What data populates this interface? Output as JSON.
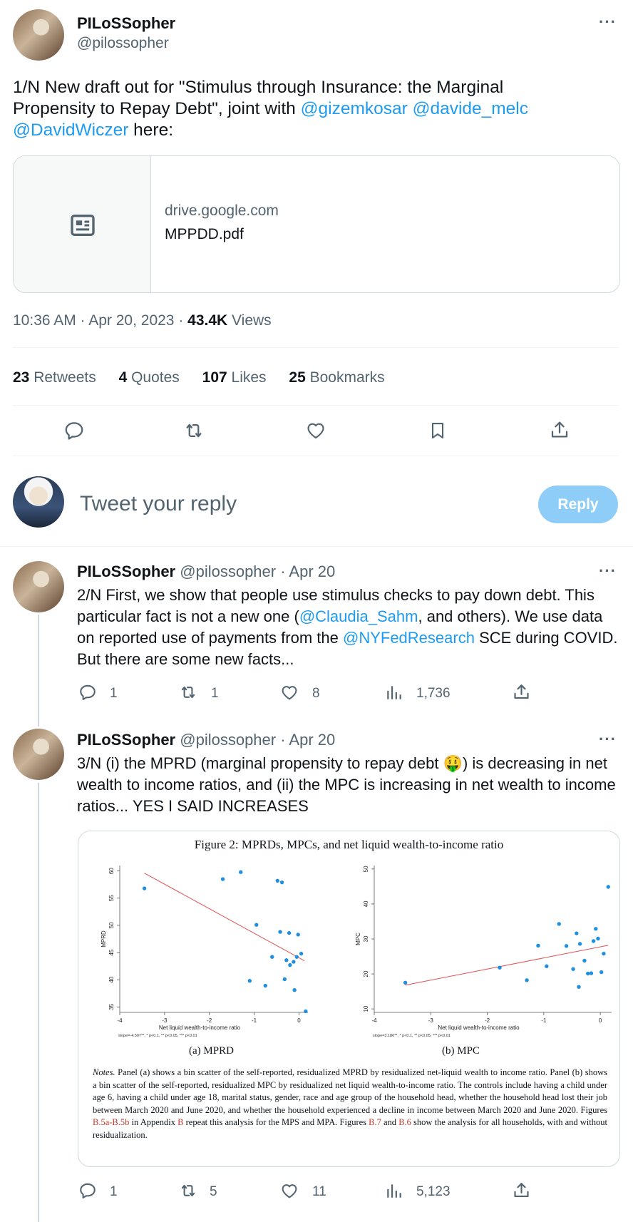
{
  "main_tweet": {
    "author_name": "PILoSSopher",
    "author_handle": "@pilossopher",
    "text_prefix": "1/N New draft out for \"Stimulus through Insurance: the Marginal Propensity to Repay Debt\", joint with ",
    "mention1": "@gizemkosar",
    "mention2": "@davide_melc",
    "mention3": "@DavidWiczer",
    "text_suffix": " here:",
    "link_card": {
      "domain": "drive.google.com",
      "title": "MPPDD.pdf"
    },
    "meta_time": "10:36 AM · Apr 20, 2023 · ",
    "views_count": "43.4K",
    "views_label": " Views",
    "stats": [
      {
        "count": "23",
        "label": " Retweets"
      },
      {
        "count": "4",
        "label": " Quotes"
      },
      {
        "count": "107",
        "label": " Likes"
      },
      {
        "count": "25",
        "label": " Bookmarks"
      }
    ],
    "more": "···"
  },
  "reply_box": {
    "placeholder": "Tweet your reply",
    "button": "Reply"
  },
  "replies": [
    {
      "author_name": "PILoSSopher",
      "handle_date": "@pilossopher · Apr 20",
      "more": "···",
      "text_a": "2/N First, we show that people use stimulus checks to pay down debt. This particular fact is not a new one (",
      "mention_a": "@Claudia_Sahm",
      "text_b": ", and others). We use data on reported use of payments from the ",
      "mention_b": "@NYFedResearch",
      "text_c": " SCE during COVID. But there are some new facts...",
      "actions": {
        "replies": "1",
        "retweets": "1",
        "likes": "8",
        "views": "1,736"
      }
    },
    {
      "author_name": "PILoSSopher",
      "handle_date": "@pilossopher · Apr 20",
      "more": "···",
      "text_a": "3/N (i) the MPRD (marginal propensity to repay debt ",
      "emoji": "🤑",
      "text_b": ") is decreasing in net wealth to income ratios, and (ii) the MPC is increasing in net wealth to income ratios... YES I SAID INCREASES",
      "actions": {
        "replies": "1",
        "retweets": "5",
        "likes": "11",
        "views": "5,123"
      }
    }
  ],
  "figure": {
    "title": "Figure 2: MPRDs, MPCs, and net liquid wealth-to-income ratio",
    "notes_label": "Notes.",
    "notes_1": " Panel (a) shows a bin scatter of the self-reported, residualized MPRD by residualized net-liquid wealth to income ratio. Panel (b) shows a bin scatter of the self-reported, residualized MPC by residualized net liquid wealth-to-income ratio.  The controls include having a child under age 6, having a child under age 18, marital status, gender, race and age group of the household head, whether the household head lost their job between March 2020 and June 2020, and whether the household experienced a decline in income between March 2020 and June 2020. Figures ",
    "notes_ref1": "B.5a-B.5b",
    "notes_2": " in Appendix ",
    "notes_ref2": "B",
    "notes_3": " repeat this analysis for the MPS and MPA. Figures ",
    "notes_ref3": "B.7",
    "notes_4": " and ",
    "notes_ref4": "B.6",
    "notes_5": " show the analysis for all households, with and without residualization."
  },
  "chart_data": [
    {
      "type": "scatter",
      "panel_caption": "(a) MPRD",
      "xlabel": "Net liquid wealth-to-income ratio",
      "ylabel": "MPRD",
      "footnote": "slope=-4.507**, * p<0.1, ** p<0.05, *** p<0.01",
      "xlim": [
        -4,
        0.2
      ],
      "ylim": [
        34,
        61
      ],
      "x_ticks": [
        "-4",
        "-3",
        "-2",
        "-1",
        "0"
      ],
      "x_tick_values": [
        -4,
        -3,
        -2,
        -1,
        0
      ],
      "y_ticks": [
        "35",
        "40",
        "45",
        "50",
        "55",
        "60"
      ],
      "y_tick_values": [
        35,
        40,
        45,
        50,
        55,
        60
      ],
      "points": [
        {
          "x": -3.45,
          "y": 56.8
        },
        {
          "x": -1.7,
          "y": 58.5
        },
        {
          "x": -1.3,
          "y": 59.8
        },
        {
          "x": -0.95,
          "y": 50.1
        },
        {
          "x": -1.1,
          "y": 39.8
        },
        {
          "x": -0.75,
          "y": 38.9
        },
        {
          "x": -0.6,
          "y": 44.2
        },
        {
          "x": -0.48,
          "y": 58.2
        },
        {
          "x": -0.38,
          "y": 57.9
        },
        {
          "x": -0.42,
          "y": 48.8
        },
        {
          "x": -0.22,
          "y": 48.6
        },
        {
          "x": -0.02,
          "y": 48.3
        },
        {
          "x": -0.28,
          "y": 43.6
        },
        {
          "x": -0.2,
          "y": 42.7
        },
        {
          "x": -0.12,
          "y": 43.3
        },
        {
          "x": -0.05,
          "y": 44.2
        },
        {
          "x": 0.05,
          "y": 44.8
        },
        {
          "x": -0.32,
          "y": 40.1
        },
        {
          "x": -0.1,
          "y": 38.1
        },
        {
          "x": 0.15,
          "y": 34.2
        }
      ],
      "fit_line": [
        {
          "x": -3.45,
          "y": 59.6
        },
        {
          "x": 0.12,
          "y": 43.5
        }
      ],
      "point_color": "#1f8fe0",
      "line_color": "#e05252"
    },
    {
      "type": "scatter",
      "panel_caption": "(b) MPC",
      "xlabel": "Net liquid wealth-to-income ratio",
      "ylabel": "MPC",
      "footnote": "slope=3.186**, * p<0.1, ** p<0.05, *** p<0.01",
      "xlim": [
        -4,
        0.2
      ],
      "ylim": [
        9,
        51
      ],
      "x_ticks": [
        "-4",
        "-3",
        "-2",
        "-1",
        "0"
      ],
      "x_tick_values": [
        -4,
        -3,
        -2,
        -1,
        0
      ],
      "y_ticks": [
        "10",
        "20",
        "30",
        "40",
        "50"
      ],
      "y_tick_values": [
        10,
        20,
        30,
        40,
        50
      ],
      "points": [
        {
          "x": -3.45,
          "y": 17.5
        },
        {
          "x": -1.78,
          "y": 21.8
        },
        {
          "x": -1.3,
          "y": 18.2
        },
        {
          "x": -1.1,
          "y": 28.1
        },
        {
          "x": -0.95,
          "y": 22.2
        },
        {
          "x": -0.73,
          "y": 34.3
        },
        {
          "x": -0.6,
          "y": 28.0
        },
        {
          "x": -0.48,
          "y": 21.4
        },
        {
          "x": -0.42,
          "y": 31.6
        },
        {
          "x": -0.36,
          "y": 28.6
        },
        {
          "x": -0.28,
          "y": 23.8
        },
        {
          "x": -0.22,
          "y": 20.1
        },
        {
          "x": -0.16,
          "y": 20.2
        },
        {
          "x": -0.12,
          "y": 29.4
        },
        {
          "x": -0.08,
          "y": 32.9
        },
        {
          "x": -0.04,
          "y": 30.1
        },
        {
          "x": 0.02,
          "y": 20.5
        },
        {
          "x": 0.06,
          "y": 25.8
        },
        {
          "x": -0.38,
          "y": 16.3
        },
        {
          "x": 0.14,
          "y": 44.9
        }
      ],
      "fit_line": [
        {
          "x": -3.45,
          "y": 16.8
        },
        {
          "x": 0.14,
          "y": 28.2
        }
      ],
      "point_color": "#1f8fe0",
      "line_color": "#e05252"
    }
  ]
}
